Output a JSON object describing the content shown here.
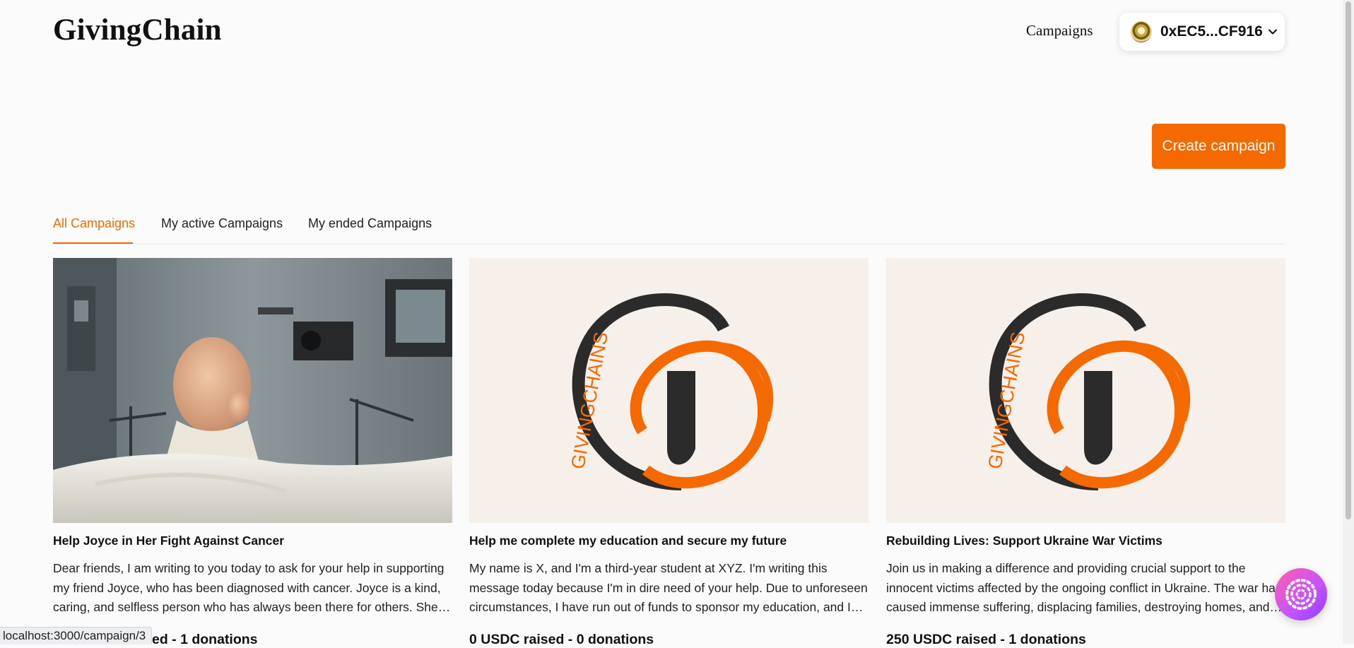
{
  "header": {
    "logo": "GivingChain",
    "nav_campaigns": "Campaigns",
    "wallet_address": "0xEC5...CF916"
  },
  "actions": {
    "create_campaign": "Create campaign"
  },
  "tabs": [
    {
      "label": "All Campaigns",
      "active": true
    },
    {
      "label": "My active Campaigns",
      "active": false
    },
    {
      "label": "My ended Campaigns",
      "active": false
    }
  ],
  "campaigns": [
    {
      "title": "Help Joyce in Her Fight Against Cancer",
      "description": "Dear friends, I am writing to you today to ask for your help in supporting my friend Joyce, who has been diagnosed with cancer. Joyce is a kind, caring, and selfless person who has always been there for others. She…",
      "stats": "ed - 1 donations",
      "image": "child-in-hospital-bed-photo"
    },
    {
      "title": "Help me complete my education and secure my future",
      "description": "My name is X, and I'm a third-year student at XYZ. I'm writing this message today because I'm in dire need of your help. Due to unforeseen circumstances, I have run out of funds to sponsor my education, and I…",
      "stats": "0 USDC raised - 0 donations",
      "image": "givingchains-logo",
      "logo_text": "GIVINGCHAINS"
    },
    {
      "title": "Rebuilding Lives: Support Ukraine War Victims",
      "description": "Join us in making a difference and providing crucial support to the innocent victims affected by the ongoing conflict in Ukraine. The war has caused immense suffering, displacing families, destroying homes, and…",
      "stats": "250 USDC raised - 1 donations",
      "image": "givingchains-logo",
      "logo_text": "GIVINGCHAINS"
    }
  ],
  "status_bar": {
    "url": "localhost:3000/campaign/3"
  },
  "colors": {
    "accent": "#f56a00",
    "logo_dark": "#2b2b2b",
    "logo_bg": "#f7efe9"
  }
}
